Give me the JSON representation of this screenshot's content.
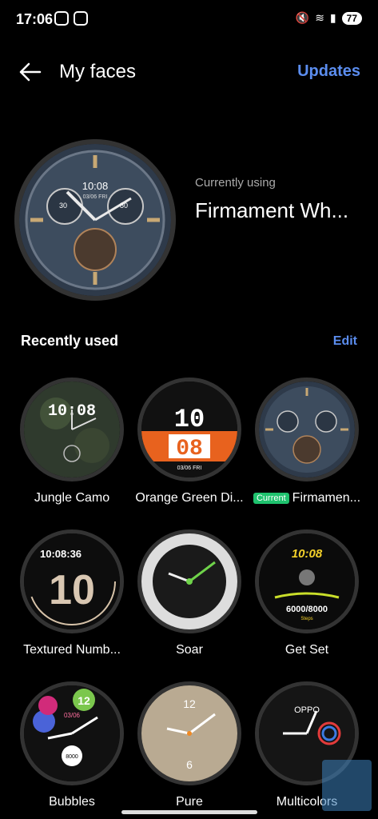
{
  "status": {
    "time": "17:06",
    "battery": "77"
  },
  "header": {
    "title": "My faces",
    "updates_label": "Updates"
  },
  "current": {
    "label": "Currently using",
    "name": "Firmament Wh..."
  },
  "recent": {
    "title": "Recently used",
    "edit_label": "Edit"
  },
  "faces": [
    {
      "name": "Jungle Camo"
    },
    {
      "name": "Orange Green Di..."
    },
    {
      "name": "Firmamen...",
      "badge": "Current"
    },
    {
      "name": "Textured Numb..."
    },
    {
      "name": "Soar"
    },
    {
      "name": "Get Set"
    },
    {
      "name": "Bubbles"
    },
    {
      "name": "Pure"
    },
    {
      "name": "Multicolors"
    }
  ],
  "face_texts": {
    "firmament_time": "10:08",
    "firmament_date": "03/06 FRI",
    "firmament_sub_left": "30",
    "firmament_sub_right": "80",
    "jungle_time": "10:08",
    "orange_hour": "10",
    "orange_min": "08",
    "orange_date": "03/06 FRI",
    "textured_time": "10:08:36",
    "textured_big": "10",
    "getset_time": "10:08",
    "getset_steps": "6000/8000",
    "getset_unit": "Steps",
    "bubbles_12": "12",
    "bubbles_date": "03/06",
    "bubbles_value": "8000",
    "pure_12": "12",
    "pure_6": "6",
    "multi_brand": "OPPO"
  },
  "colors": {
    "accent": "#5b8def",
    "badge": "#1fc26e"
  }
}
